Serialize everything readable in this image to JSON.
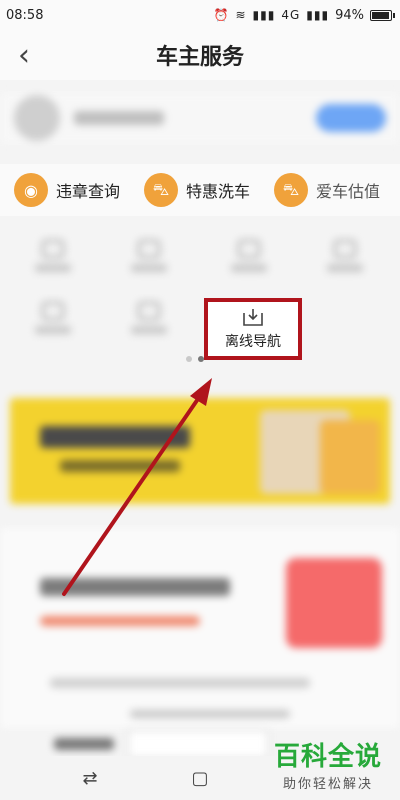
{
  "status_bar": {
    "time": "08:58",
    "network": "4G",
    "battery": "94%",
    "battery_level": 0.94
  },
  "header": {
    "title": "车主服务",
    "back_icon": "chevron-left-icon"
  },
  "quick_services": [
    {
      "label": "违章查询",
      "icon": "ticket-icon"
    },
    {
      "label": "特惠洗车",
      "icon": "car-wash-icon"
    },
    {
      "label": "爱车估值",
      "icon": "car-value-icon"
    }
  ],
  "highlight": {
    "label": "离线导航",
    "icon": "offline-download-icon",
    "border_color": "#b0141c"
  },
  "pagination": {
    "total": 2,
    "active": 2
  },
  "watermark": {
    "main": "百科全说",
    "sub": "助你轻松解决"
  },
  "nav_bar": {
    "recent_icon": "swap-icon",
    "back_icon": "square-icon"
  },
  "colors": {
    "accent_orange": "#f0a23b",
    "highlight_red": "#b0141c",
    "banner_yellow": "#f3d22e",
    "watermark_green": "#27a93a"
  }
}
